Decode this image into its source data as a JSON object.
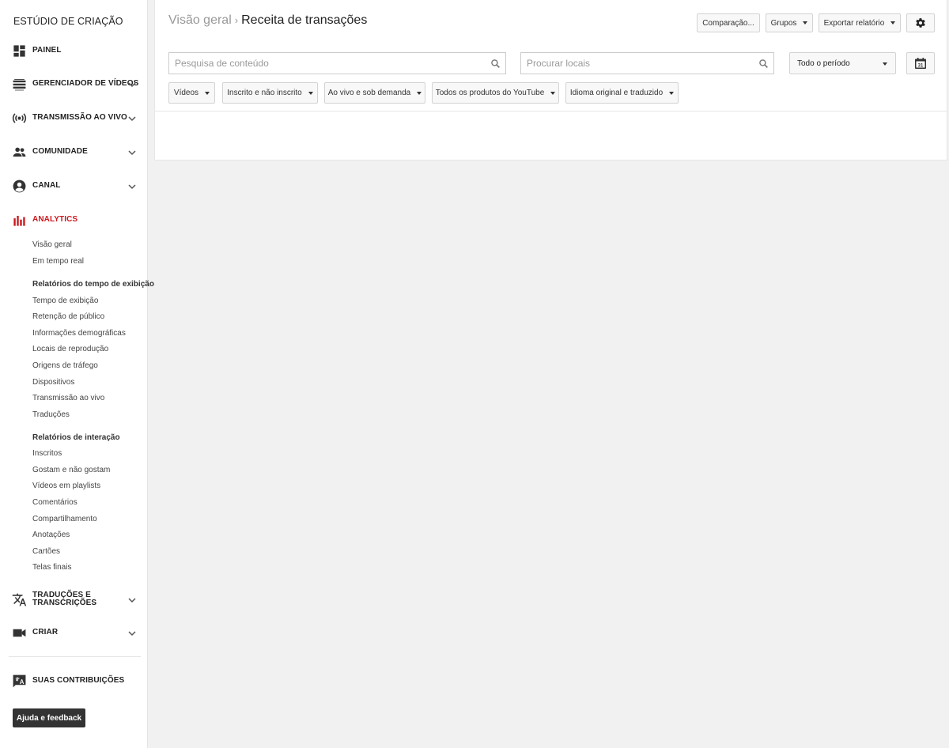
{
  "sidebar": {
    "title": "ESTÚDIO DE CRIAÇÃO",
    "items": [
      {
        "label": "PAINEL",
        "icon": "dashboard-icon"
      },
      {
        "label": "GERENCIADOR DE VÍDEOS",
        "icon": "video-manager-icon"
      },
      {
        "label": "TRANSMISSÃO AO VIVO",
        "icon": "live-stream-icon"
      },
      {
        "label": "COMUNIDADE",
        "icon": "community-icon"
      },
      {
        "label": "CANAL",
        "icon": "channel-icon"
      },
      {
        "label": "ANALYTICS",
        "icon": "analytics-icon"
      },
      {
        "label": "TRADUÇÕES E TRANSCRIÇÕES",
        "icon": "translate-icon"
      },
      {
        "label": "CRIAR",
        "icon": "create-icon"
      },
      {
        "label": "SUAS CONTRIBUIÇÕES",
        "icon": "contributions-icon"
      }
    ],
    "analytics_sub": {
      "overview": "Visão geral",
      "realtime": "Em tempo real",
      "watch_head": "Relatórios do tempo de exibição",
      "watch": [
        "Tempo de exibição",
        "Retenção de público",
        "Informações demográficas",
        "Locais de reprodução",
        "Origens de tráfego",
        "Dispositivos",
        "Transmissão ao vivo",
        "Traduções"
      ],
      "interaction_head": "Relatórios de interação",
      "interaction": [
        "Inscritos",
        "Gostam e não gostam",
        "Vídeos em playlists",
        "Comentários",
        "Compartilhamento",
        "Anotações",
        "Cartões",
        "Telas finais"
      ]
    },
    "help_label": "Ajuda e feedback",
    "active_color": "#cc181e"
  },
  "header": {
    "parent": "Visão geral",
    "separator": "›",
    "current": "Receita de transações",
    "buttons": {
      "comparison": "Comparação...",
      "groups": "Grupos",
      "export": "Exportar relatório"
    }
  },
  "search": {
    "content_placeholder": "Pesquisa de conteúdo",
    "locations_placeholder": "Procurar locais"
  },
  "period": {
    "selected": "Todo o período"
  },
  "calendar": {
    "day": "31"
  },
  "filters": {
    "videos": "Vídeos",
    "subscribed": "Inscrito e não inscrito",
    "live": "Ao vivo e sob demanda",
    "products": "Todos os produtos do YouTube",
    "language": "Idioma original e traduzido"
  }
}
